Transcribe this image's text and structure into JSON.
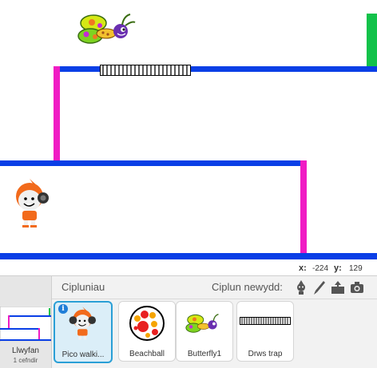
{
  "coords": {
    "x_label": "x:",
    "x_value": "-224",
    "y_label": "y:",
    "y_value": "129"
  },
  "stage_panel": {
    "name": "Llwyfan",
    "backdrops": "1 cefndir"
  },
  "sprites_panel": {
    "title": "Cipluniau",
    "new_sprite_label": "Ciplun newydd:",
    "tools": [
      "choose-from-library-icon",
      "paint-brush-icon",
      "upload-icon",
      "camera-icon"
    ]
  },
  "sprites": [
    {
      "name": "Pico walki...",
      "selected": true,
      "info": "i"
    },
    {
      "name": "Beachball",
      "selected": false
    },
    {
      "name": "Butterfly1",
      "selected": false
    },
    {
      "name": "Drws trap",
      "selected": false
    }
  ],
  "colors": {
    "platform_blue": "#0a3fe6",
    "wall_pink": "#f01cc4",
    "goal_green": "#12c24a",
    "selection_blue": "#2a9fd6"
  }
}
